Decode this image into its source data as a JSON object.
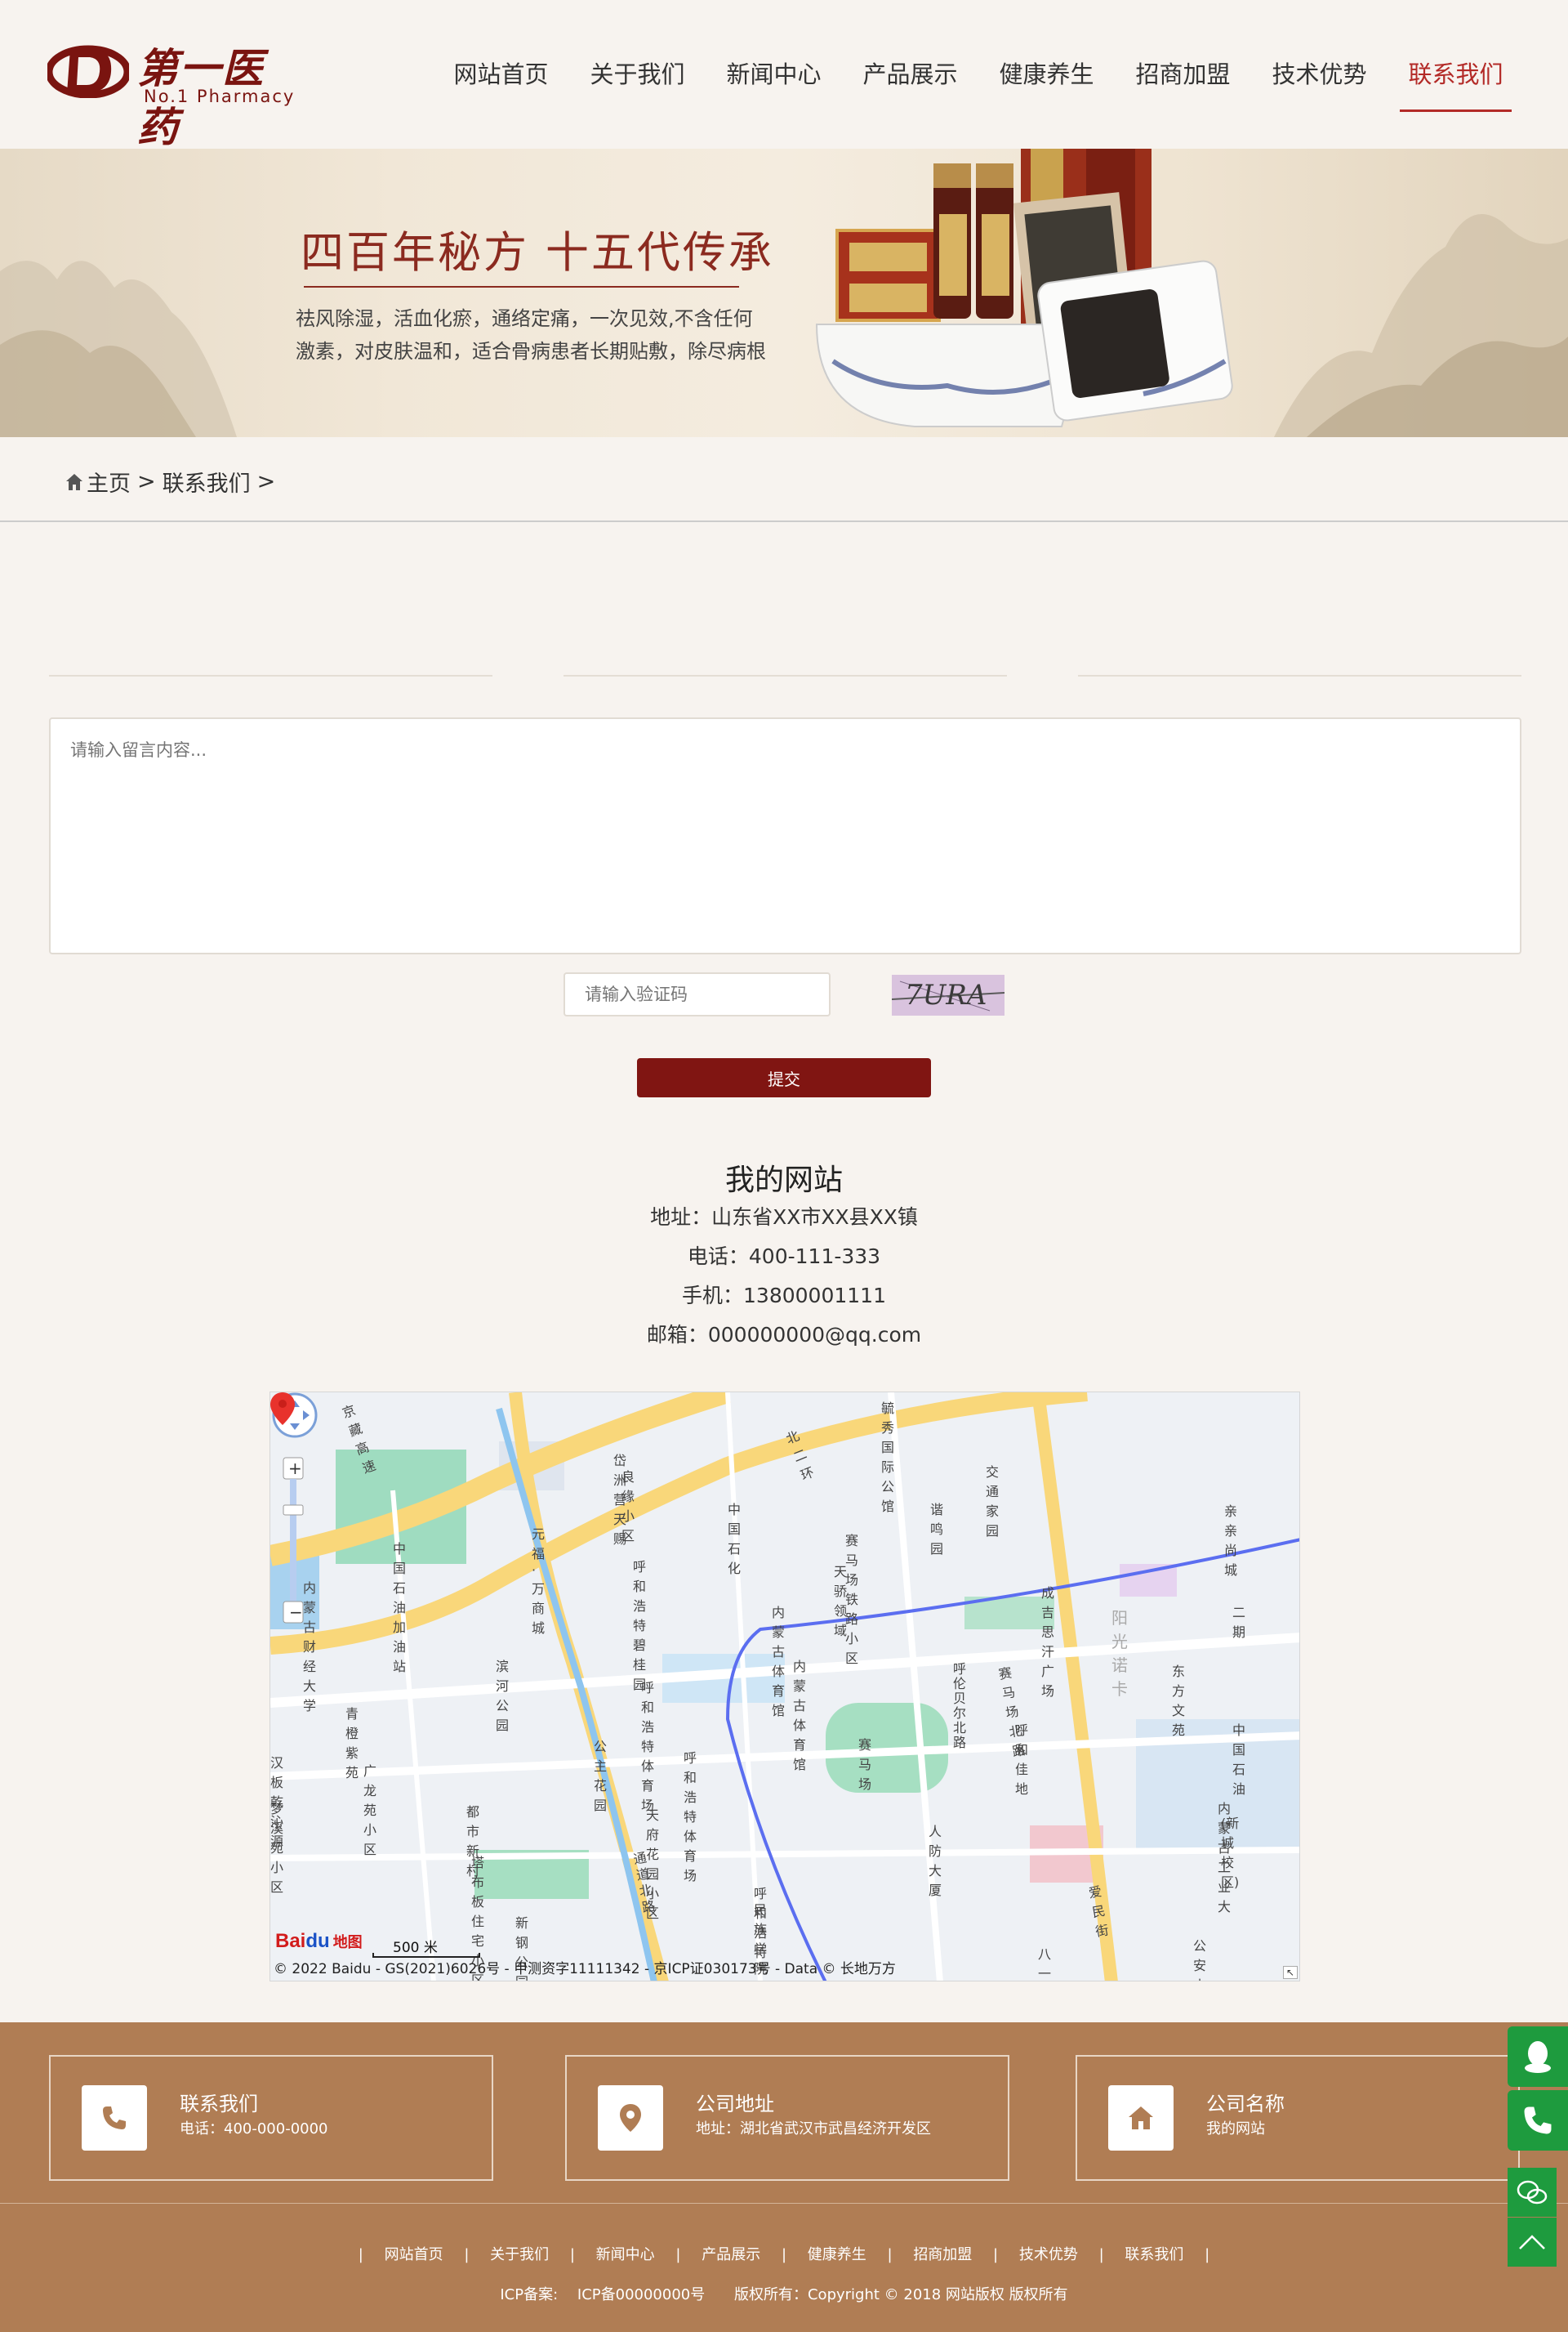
{
  "brand": {
    "name_cn": "第一医药",
    "name_en": "No.1 Pharmacy"
  },
  "nav": {
    "items": [
      {
        "label": "网站首页"
      },
      {
        "label": "关于我们"
      },
      {
        "label": "新闻中心"
      },
      {
        "label": "产品展示"
      },
      {
        "label": "健康养生"
      },
      {
        "label": "招商加盟"
      },
      {
        "label": "技术优势"
      },
      {
        "label": "联系我们"
      }
    ],
    "active_index": 7
  },
  "banner": {
    "title": "四百年秘方 十五代传承",
    "desc_line1": "祛风除湿，活血化瘀，通络定痛，一次见效,不含任何",
    "desc_line2": "激素，对皮肤温和，适合骨病患者长期贴敷，除尽病根"
  },
  "breadcrumb": {
    "home": "主页",
    "sep": ">",
    "current": "联系我们"
  },
  "form": {
    "message_placeholder": "请输入留言内容...",
    "captcha_placeholder": "请输入验证码",
    "captcha_text": "7URA",
    "submit_label": "提交"
  },
  "contact": {
    "site_name": "我的网站",
    "address": "地址：山东省XX市XX县XX镇",
    "phone": "电话：400-111-333",
    "mobile": "手机：13800001111",
    "email": "邮箱：000000000@qq.com"
  },
  "map": {
    "copyright": "© 2022 Baidu - GS(2021)6026号 - 甲测资字11111342 - 京ICP证030173号 - Data © 长地万方",
    "scale": "500 米",
    "logo_bai": "Bai",
    "logo_du": "du",
    "logo_map": "地图",
    "labels": [
      {
        "text": "京藏高速"
      },
      {
        "text": "北二环"
      },
      {
        "text": "毓秀国际公馆"
      },
      {
        "text": "岱洲营天赐"
      },
      {
        "text": "良缘小区"
      },
      {
        "text": "交通家园"
      },
      {
        "text": "中国石化"
      },
      {
        "text": "谐鸣园"
      },
      {
        "text": "亲亲尚城"
      },
      {
        "text": "元福·万商城"
      },
      {
        "text": "中国石油加油站"
      },
      {
        "text": "赛马场铁路小区"
      },
      {
        "text": "呼和浩特碧桂园"
      },
      {
        "text": "天骄领域"
      },
      {
        "text": "内蒙古财经大学"
      },
      {
        "text": "成吉思汗广场"
      },
      {
        "text": "阳光诺卡"
      },
      {
        "text": "二期"
      },
      {
        "text": "内蒙古体育馆"
      },
      {
        "text": "滨河公园"
      },
      {
        "text": "呼和浩特体育场"
      },
      {
        "text": "内蒙古体育馆"
      },
      {
        "text": "赛马场北路"
      },
      {
        "text": "东方文苑"
      },
      {
        "text": "青橙紫苑"
      },
      {
        "text": "呼伦贝尔北路"
      },
      {
        "text": "呼和佳地"
      },
      {
        "text": "中国石油"
      },
      {
        "text": "公主花园"
      },
      {
        "text": "汉板乾沁源"
      },
      {
        "text": "广龙苑小区"
      },
      {
        "text": "赛马场"
      },
      {
        "text": "呼和浩特体育场"
      },
      {
        "text": "梦溪苑小区"
      },
      {
        "text": "都市新村"
      },
      {
        "text": "天府花园小区"
      },
      {
        "text": "人防大厦"
      },
      {
        "text": "内蒙古工业大"
      },
      {
        "text": "(新城校区)"
      },
      {
        "text": "塔布板住宅小区"
      },
      {
        "text": "通道北路"
      },
      {
        "text": "呼和浩特"
      },
      {
        "text": "民族学院"
      },
      {
        "text": "爱民街"
      },
      {
        "text": "新钢公园"
      },
      {
        "text": "八一小区"
      },
      {
        "text": "公安小区"
      }
    ]
  },
  "footer": {
    "boxes": [
      {
        "title": "联系我们",
        "sub": "电话：400-000-0000",
        "icon": "phone-icon"
      },
      {
        "title": "公司地址",
        "sub": "地址：湖北省武汉市武昌经济开发区",
        "icon": "location-pin-icon"
      },
      {
        "title": "公司名称",
        "sub": "我的网站",
        "icon": "home-icon"
      }
    ],
    "nav": [
      "网站首页",
      "关于我们",
      "新闻中心",
      "产品展示",
      "健康养生",
      "招商加盟",
      "技术优势",
      "联系我们"
    ],
    "nav_sep": "|",
    "icp_label": "ICP备案:",
    "icp_value": "ICP备00000000号",
    "copyright": "版权所有：Copyright © 2018 网站版权 版权所有"
  },
  "colors": {
    "accent": "#b32a27",
    "submit": "#801512",
    "footer": "#b07d54",
    "side": "#1e9b3e",
    "page": "#f7f3ef"
  }
}
